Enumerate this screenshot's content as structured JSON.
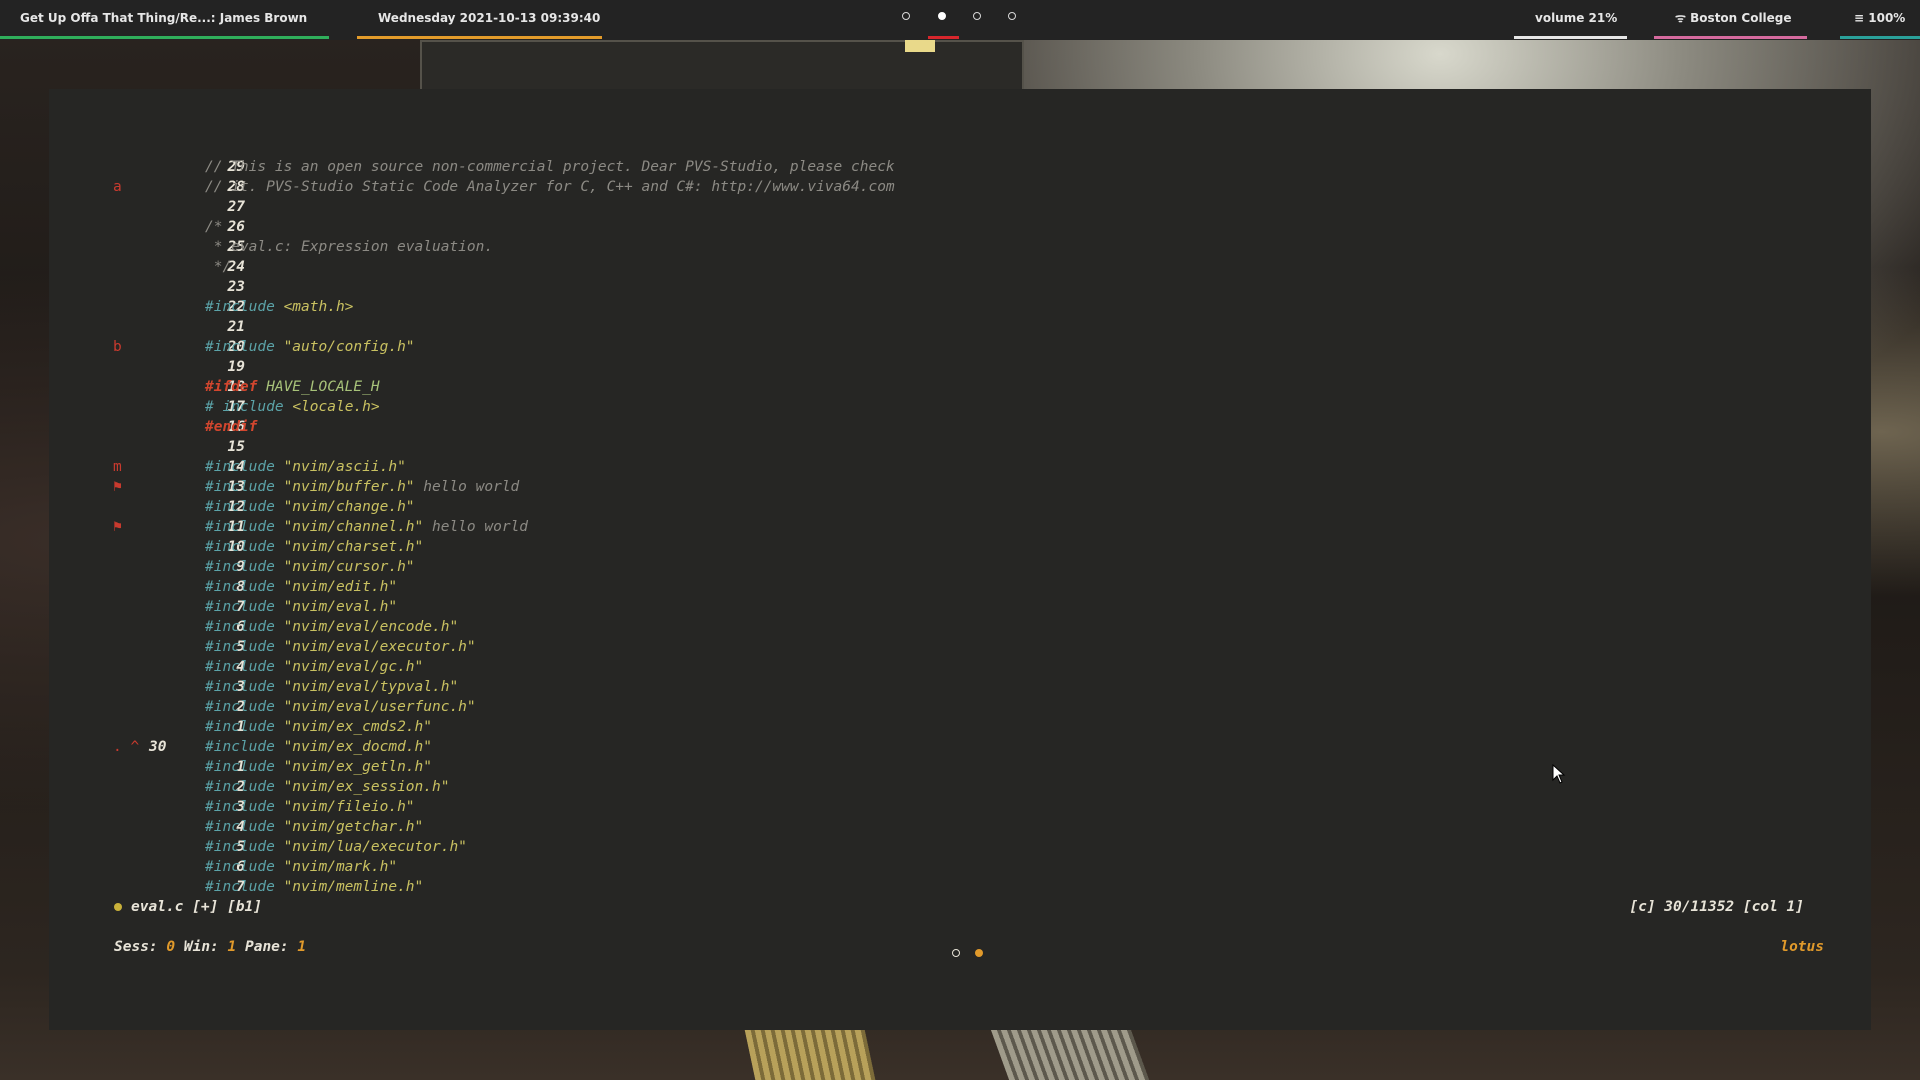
{
  "topbar": {
    "now_playing": "Get Up Offa That Thing/Re...: James Brown",
    "datetime": "Wednesday 2021-10-13 09:39:40",
    "workspaces": [
      {
        "label": "",
        "active": false
      },
      {
        "label": "",
        "active": true
      },
      {
        "label": "",
        "active": false
      },
      {
        "label": "",
        "active": false
      }
    ],
    "volume": "volume 21%",
    "wifi": "Boston College",
    "battery": "100%",
    "colors": {
      "green": "#2fae5b",
      "orange": "#e39b2a",
      "red": "#d7262c",
      "white": "#e6e6e6",
      "pink": "#d56a9e",
      "teal": "#2aa19a"
    }
  },
  "editor": {
    "lines": [
      {
        "mark": "",
        "num": "29",
        "tokens": [
          {
            "t": "// This is an open source non-commercial project. Dear PVS-Studio, please check",
            "c": "c-comment"
          }
        ]
      },
      {
        "mark": "a",
        "num": "28",
        "tokens": [
          {
            "t": "// it. PVS-Studio Static Code Analyzer for C, C++ and C#: http://www.viva64.com",
            "c": "c-comment"
          }
        ]
      },
      {
        "mark": "",
        "num": "27",
        "tokens": []
      },
      {
        "mark": "",
        "num": "26",
        "tokens": [
          {
            "t": "/*",
            "c": "c-comment"
          }
        ]
      },
      {
        "mark": "",
        "num": "25",
        "tokens": [
          {
            "t": " * eval.c: Expression evaluation.",
            "c": "c-comment"
          }
        ]
      },
      {
        "mark": "",
        "num": "24",
        "tokens": [
          {
            "t": " */",
            "c": "c-comment"
          }
        ]
      },
      {
        "mark": "",
        "num": "23",
        "tokens": []
      },
      {
        "mark": "",
        "num": "22",
        "tokens": [
          {
            "t": "#include ",
            "c": "c-inc"
          },
          {
            "t": "<math.h>",
            "c": "c-str"
          }
        ]
      },
      {
        "mark": "",
        "num": "21",
        "tokens": []
      },
      {
        "mark": "b",
        "num": "20",
        "tokens": [
          {
            "t": "#include ",
            "c": "c-inc"
          },
          {
            "t": "\"auto/config.h\"",
            "c": "c-str"
          }
        ]
      },
      {
        "mark": "",
        "num": "19",
        "tokens": []
      },
      {
        "mark": "",
        "num": "18",
        "tokens": [
          {
            "t": "#ifdef ",
            "c": "c-macro"
          },
          {
            "t": "HAVE_LOCALE_H",
            "c": "c-ident"
          }
        ]
      },
      {
        "mark": "",
        "num": "17",
        "tokens": [
          {
            "t": "# include ",
            "c": "c-inc"
          },
          {
            "t": "<locale.h>",
            "c": "c-str"
          }
        ]
      },
      {
        "mark": "",
        "num": "16",
        "tokens": [
          {
            "t": "#endif",
            "c": "c-macro"
          }
        ]
      },
      {
        "mark": "",
        "num": "15",
        "tokens": []
      },
      {
        "mark": "m",
        "num": "14",
        "tokens": [
          {
            "t": "#include ",
            "c": "c-inc"
          },
          {
            "t": "\"nvim/ascii.h\"",
            "c": "c-str"
          }
        ]
      },
      {
        "mark": "⚑",
        "num": "13",
        "tokens": [
          {
            "t": "#include ",
            "c": "c-inc"
          },
          {
            "t": "\"nvim/buffer.h\"",
            "c": "c-str"
          },
          {
            "t": " hello world",
            "c": "c-plain"
          }
        ]
      },
      {
        "mark": "",
        "num": "12",
        "tokens": [
          {
            "t": "#include ",
            "c": "c-inc"
          },
          {
            "t": "\"nvim/change.h\"",
            "c": "c-str"
          }
        ]
      },
      {
        "mark": "⚑",
        "num": "11",
        "tokens": [
          {
            "t": "#include ",
            "c": "c-inc"
          },
          {
            "t": "\"nvim/channel.h\"",
            "c": "c-str"
          },
          {
            "t": " hello world",
            "c": "c-plain"
          }
        ]
      },
      {
        "mark": "",
        "num": "10",
        "tokens": [
          {
            "t": "#include ",
            "c": "c-inc"
          },
          {
            "t": "\"nvim/charset.h\"",
            "c": "c-str"
          }
        ]
      },
      {
        "mark": "",
        "num": "9",
        "tokens": [
          {
            "t": "#include ",
            "c": "c-inc"
          },
          {
            "t": "\"nvim/cursor.h\"",
            "c": "c-str"
          }
        ]
      },
      {
        "mark": "",
        "num": "8",
        "tokens": [
          {
            "t": "#include ",
            "c": "c-inc"
          },
          {
            "t": "\"nvim/edit.h\"",
            "c": "c-str"
          }
        ]
      },
      {
        "mark": "",
        "num": "7",
        "tokens": [
          {
            "t": "#include ",
            "c": "c-inc"
          },
          {
            "t": "\"nvim/eval.h\"",
            "c": "c-str"
          }
        ]
      },
      {
        "mark": "",
        "num": "6",
        "tokens": [
          {
            "t": "#include ",
            "c": "c-inc"
          },
          {
            "t": "\"nvim/eval/encode.h\"",
            "c": "c-str"
          }
        ]
      },
      {
        "mark": "",
        "num": "5",
        "tokens": [
          {
            "t": "#include ",
            "c": "c-inc"
          },
          {
            "t": "\"nvim/eval/executor.h\"",
            "c": "c-str"
          }
        ]
      },
      {
        "mark": "",
        "num": "4",
        "tokens": [
          {
            "t": "#include ",
            "c": "c-inc"
          },
          {
            "t": "\"nvim/eval/gc.h\"",
            "c": "c-str"
          }
        ]
      },
      {
        "mark": "",
        "num": "3",
        "tokens": [
          {
            "t": "#include ",
            "c": "c-inc"
          },
          {
            "t": "\"nvim/eval/typval.h\"",
            "c": "c-str"
          }
        ]
      },
      {
        "mark": "",
        "num": "2",
        "tokens": [
          {
            "t": "#include ",
            "c": "c-inc"
          },
          {
            "t": "\"nvim/eval/userfunc.h\"",
            "c": "c-str"
          }
        ]
      },
      {
        "mark": "",
        "num": "1",
        "tokens": [
          {
            "t": "#include ",
            "c": "c-inc"
          },
          {
            "t": "\"nvim/ex_cmds2.h\"",
            "c": "c-str"
          }
        ]
      },
      {
        "mark": ". ^",
        "num": "30",
        "current": true,
        "tokens": [
          {
            "t": "#include ",
            "c": "c-inc"
          },
          {
            "t": "\"nvim/ex_docmd.h\"",
            "c": "c-str"
          }
        ]
      },
      {
        "mark": "",
        "num": "1",
        "tokens": [
          {
            "t": "#include ",
            "c": "c-inc"
          },
          {
            "t": "\"nvim/ex_getln.h\"",
            "c": "c-str"
          }
        ]
      },
      {
        "mark": "",
        "num": "2",
        "tokens": [
          {
            "t": "#include ",
            "c": "c-inc"
          },
          {
            "t": "\"nvim/ex_session.h\"",
            "c": "c-str"
          }
        ]
      },
      {
        "mark": "",
        "num": "3",
        "tokens": [
          {
            "t": "#include ",
            "c": "c-inc"
          },
          {
            "t": "\"nvim/fileio.h\"",
            "c": "c-str"
          }
        ]
      },
      {
        "mark": "",
        "num": "4",
        "tokens": [
          {
            "t": "#include ",
            "c": "c-inc"
          },
          {
            "t": "\"nvim/getchar.h\"",
            "c": "c-str"
          }
        ]
      },
      {
        "mark": "",
        "num": "5",
        "tokens": [
          {
            "t": "#include ",
            "c": "c-inc"
          },
          {
            "t": "\"nvim/lua/executor.h\"",
            "c": "c-str"
          }
        ]
      },
      {
        "mark": "",
        "num": "6",
        "tokens": [
          {
            "t": "#include ",
            "c": "c-inc"
          },
          {
            "t": "\"nvim/mark.h\"",
            "c": "c-str"
          }
        ]
      },
      {
        "mark": "",
        "num": "7",
        "tokens": [
          {
            "t": "#include ",
            "c": "c-inc"
          },
          {
            "t": "\"nvim/memline.h\"",
            "c": "c-str"
          }
        ]
      }
    ],
    "statusline": {
      "filename": "eval.c [+]  [b1]",
      "position": "[c] 30/11352 [col 1]"
    }
  },
  "tmux": {
    "sess_label": "Sess:",
    "sess_value": "0",
    "win_label": "Win:",
    "win_value": "1",
    "pane_label": "Pane:",
    "pane_value": "1",
    "hostname": "lotus"
  }
}
